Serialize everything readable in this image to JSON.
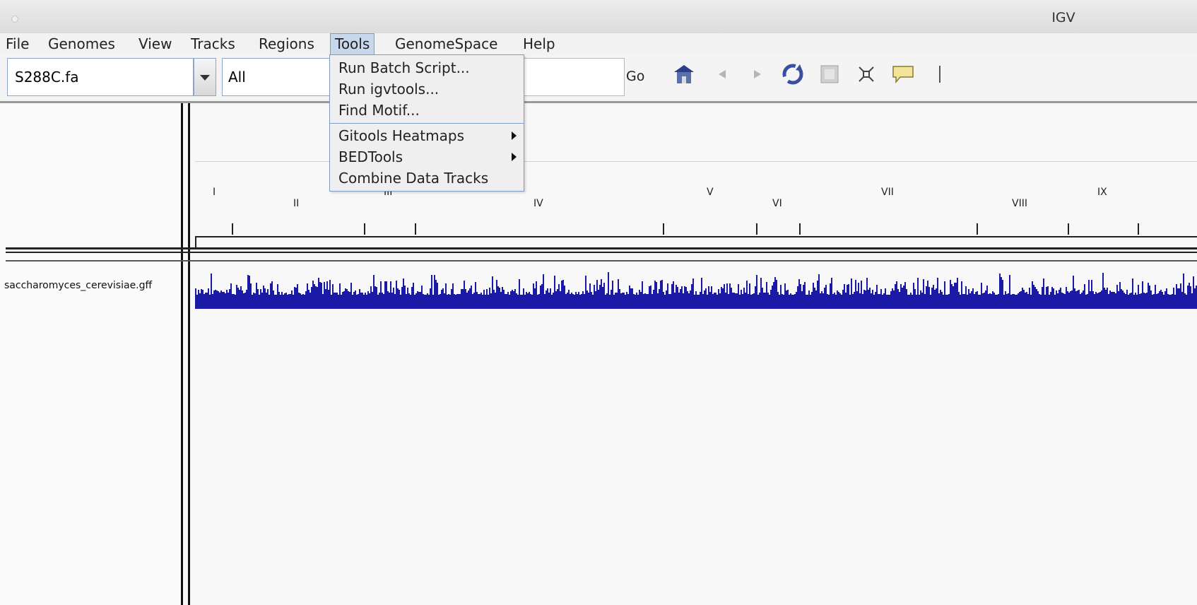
{
  "window": {
    "title": "IGV"
  },
  "menubar": {
    "items": [
      "File",
      "Genomes",
      "View",
      "Tracks",
      "Regions",
      "Tools",
      "GenomeSpace",
      "Help"
    ],
    "active": "Tools"
  },
  "toolbar": {
    "genome_value": "S288C.fa",
    "chromosome_value": "All",
    "locus_value": "",
    "go_label": "Go",
    "icons": [
      "home-icon",
      "back-icon",
      "forward-icon",
      "refresh-icon",
      "region-icon",
      "resize-icon",
      "popup-icon",
      "ruler-line-icon"
    ]
  },
  "tools_menu": {
    "items": [
      {
        "label": "Run Batch Script...",
        "submenu": false
      },
      {
        "label": "Run igvtools...",
        "submenu": false
      },
      {
        "label": "Find Motif...",
        "submenu": false
      },
      {
        "label": "Gitools Heatmaps",
        "submenu": true
      },
      {
        "label": "BEDTools",
        "submenu": true
      },
      {
        "label": "Combine Data Tracks",
        "submenu": false
      }
    ]
  },
  "ruler": {
    "chromosomes": [
      "I",
      "II",
      "III",
      "IV",
      "V",
      "VI",
      "VII",
      "VIII",
      "IX"
    ]
  },
  "tracks": [
    {
      "name": "saccharomyces_cerevisiae.gff",
      "color": "#1a1aa6"
    }
  ],
  "colors": {
    "track": "#1a1aa6",
    "menu_highlight": "#c8d8ec"
  }
}
